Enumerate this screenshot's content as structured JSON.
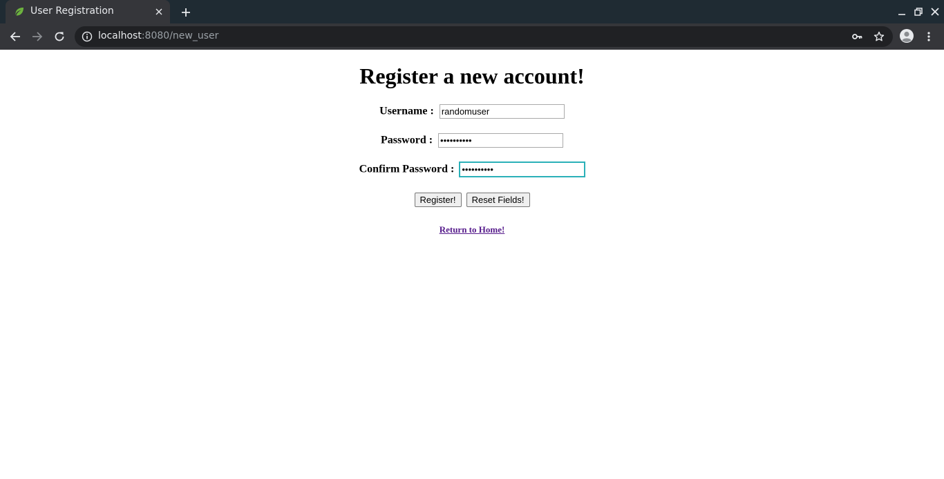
{
  "browser": {
    "tab_title": "User Registration",
    "url_host": "localhost",
    "url_rest": ":8080/new_user",
    "colors": {
      "frame": "#1f2b33",
      "toolbar": "#35363a",
      "omnibox": "#202124",
      "favicon": "#6db33f"
    }
  },
  "page": {
    "heading": "Register a new account!",
    "username_label": "Username :",
    "username_value": "randomuser",
    "password_label": "Password :",
    "password_value": "••••••••••",
    "confirm_label": "Confirm Password :",
    "confirm_value": "••••••••••",
    "register_button": "Register!",
    "reset_button": "Reset Fields!",
    "home_link": "Return to Home!",
    "colors": {
      "link_visited": "#551a8b",
      "focus_ring": "#2ab0b8"
    }
  }
}
